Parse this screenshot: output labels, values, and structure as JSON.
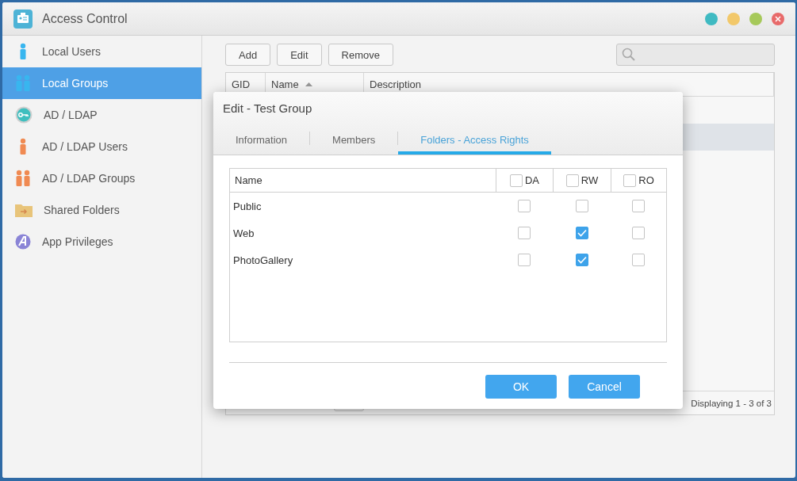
{
  "window": {
    "title": "Access Control"
  },
  "sidebar": {
    "items": [
      {
        "label": "Local Users",
        "kind": "user",
        "selected": false
      },
      {
        "label": "Local Groups",
        "kind": "group",
        "selected": true
      },
      {
        "label": "AD / LDAP",
        "kind": "directory",
        "selected": false
      },
      {
        "label": "AD / LDAP Users",
        "kind": "directory-user",
        "selected": false
      },
      {
        "label": "AD / LDAP Groups",
        "kind": "directory-group",
        "selected": false
      },
      {
        "label": "Shared Folders",
        "kind": "folder",
        "selected": false
      },
      {
        "label": "App Privileges",
        "kind": "app",
        "selected": false
      }
    ]
  },
  "toolbar": {
    "buttons": [
      "Add",
      "Edit",
      "Remove"
    ]
  },
  "groups_table": {
    "columns": [
      "GID",
      "Name",
      "Description"
    ],
    "rows": [
      {
        "selected": false
      },
      {
        "selected": true
      },
      {
        "selected": false
      }
    ],
    "footer": "Displaying 1 - 3 of 3"
  },
  "dialog": {
    "title": "Edit - Test Group",
    "tabs": [
      {
        "label": "Information",
        "selected": false
      },
      {
        "label": "Members",
        "selected": false
      },
      {
        "label": "Folders - Access Rights",
        "selected": true
      }
    ],
    "table": {
      "name_column": "Name",
      "columns": [
        {
          "label": "DA",
          "checked": false
        },
        {
          "label": "RW",
          "checked": false
        },
        {
          "label": "RO",
          "checked": false
        }
      ],
      "rows": [
        {
          "name": "Public",
          "rights": [
            false,
            false,
            false
          ]
        },
        {
          "name": "Web",
          "rights": [
            false,
            true,
            false
          ]
        },
        {
          "name": "PhotoGallery",
          "rights": [
            false,
            true,
            false
          ]
        }
      ]
    },
    "buttons": [
      "OK",
      "Cancel"
    ]
  }
}
